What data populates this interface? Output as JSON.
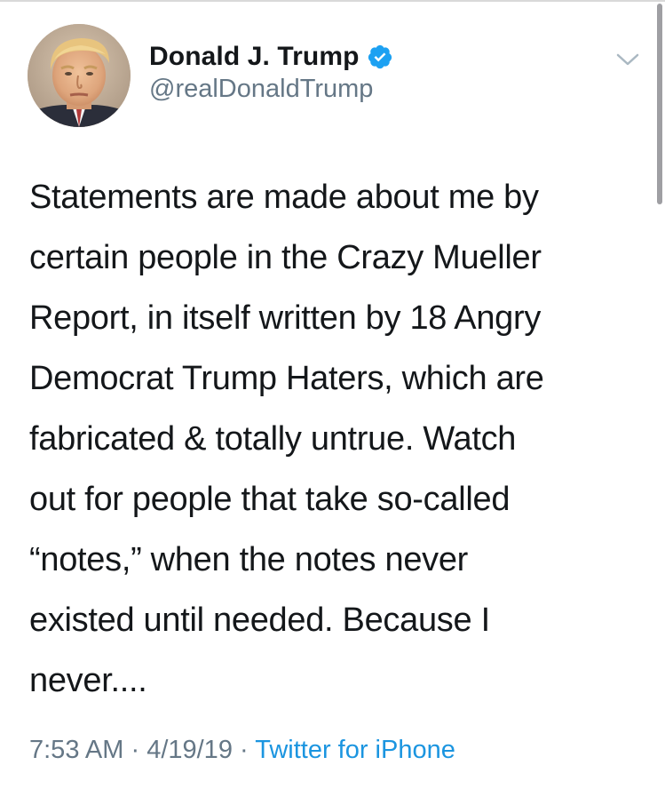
{
  "author": {
    "display_name": "Donald J. Trump",
    "handle": "@realDonaldTrump",
    "verified": true,
    "avatar_icon": "profile-photo"
  },
  "tweet": {
    "text_lines": [
      "Statements are made about me by",
      "certain people in the Crazy Mueller",
      "Report, in itself written by 18 Angry",
      "Democrat Trump Haters, which are",
      "fabricated & totally untrue. Watch",
      "out for people that take so-called",
      "“notes,” when the notes never",
      "existed until needed. Because I",
      "never...."
    ]
  },
  "meta": {
    "time": "7:53 AM",
    "separator": " · ",
    "date": "4/19/19",
    "source": "Twitter for iPhone"
  },
  "colors": {
    "text": "#14171a",
    "secondary": "#657786",
    "link": "#1b95e0",
    "verified_badge": "#1da1f2"
  },
  "icons": {
    "verified": "verified-badge-icon",
    "menu": "chevron-down-icon"
  }
}
